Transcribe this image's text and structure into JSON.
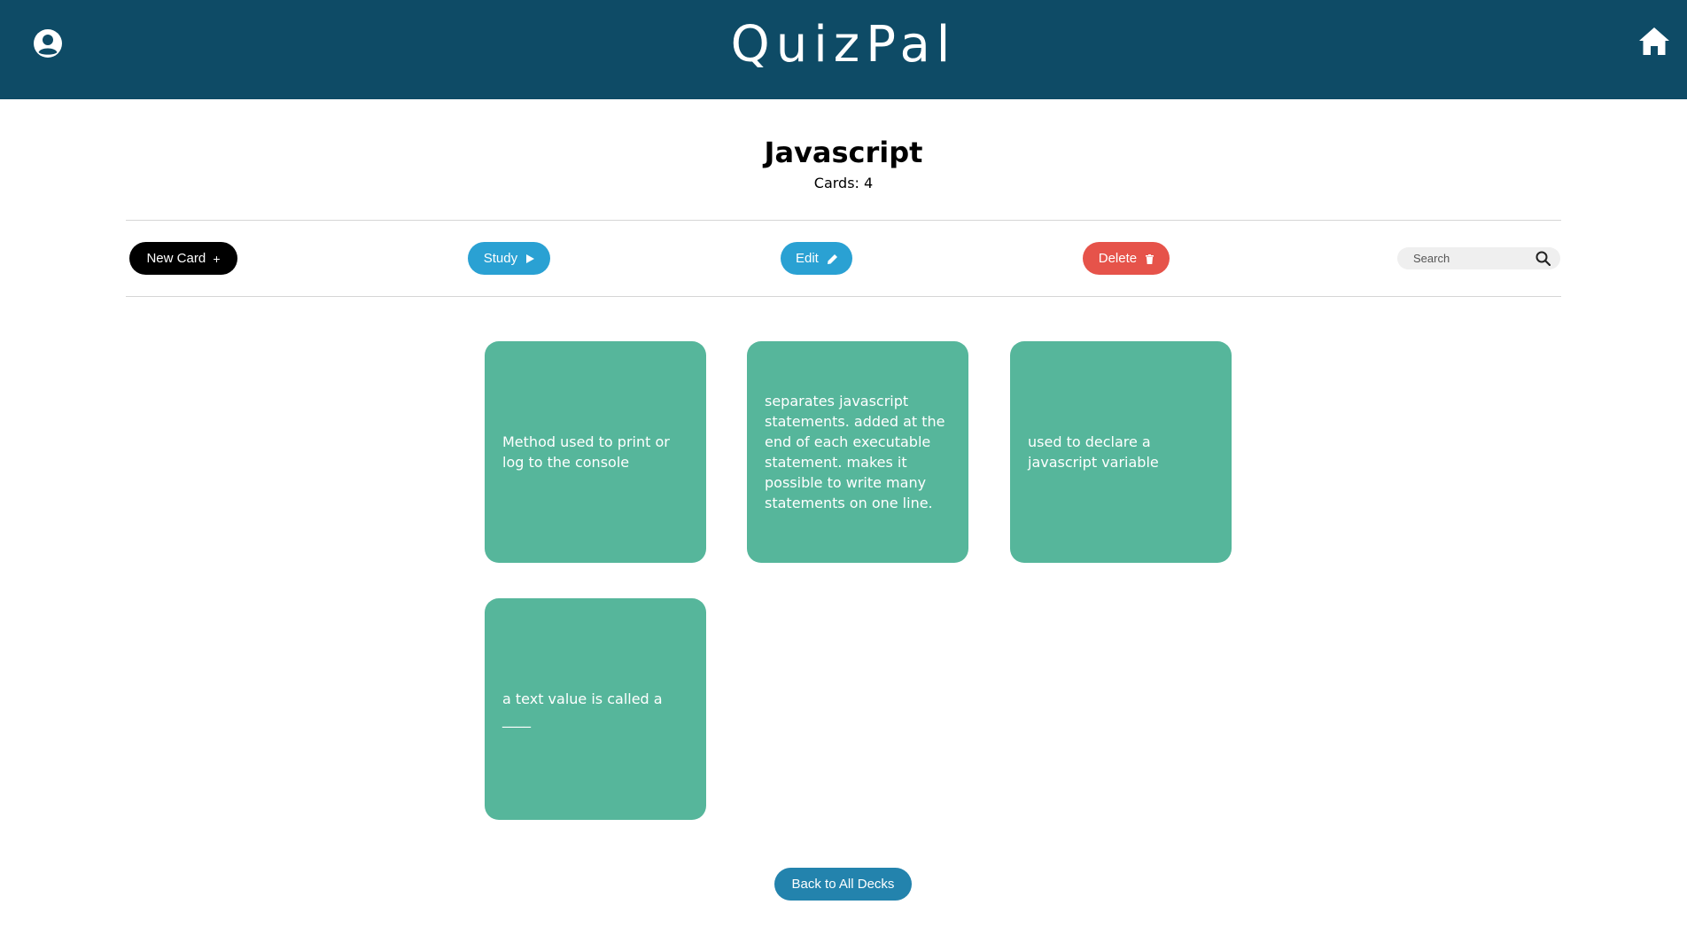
{
  "header": {
    "brand": "QuizPal",
    "user_icon": "user-circle-icon",
    "home_icon": "home-icon",
    "color": "#0e4b66"
  },
  "deck": {
    "title": "Javascript",
    "count_text": "Cards: 4"
  },
  "toolbar": {
    "new_card_label": "New Card",
    "new_card_icon": "+",
    "study_label": "Study",
    "edit_label": "Edit",
    "delete_label": "Delete",
    "search_placeholder": "Search",
    "colors": {
      "new_card": "#000000",
      "study": "#2aa1d3",
      "edit": "#2aa1d3",
      "delete": "#e6534a"
    }
  },
  "cards": [
    {
      "text": "Method used to print or log to the console"
    },
    {
      "text": "separates javascript statements. added at the end of each executable statement. makes it possible to write many statements on one line."
    },
    {
      "text": "used to declare a javascript variable"
    },
    {
      "text": "a text value is called a ____"
    }
  ],
  "card_color": "#56b69b",
  "footer": {
    "back_label": "Back to All Decks",
    "color": "#2383ad"
  }
}
